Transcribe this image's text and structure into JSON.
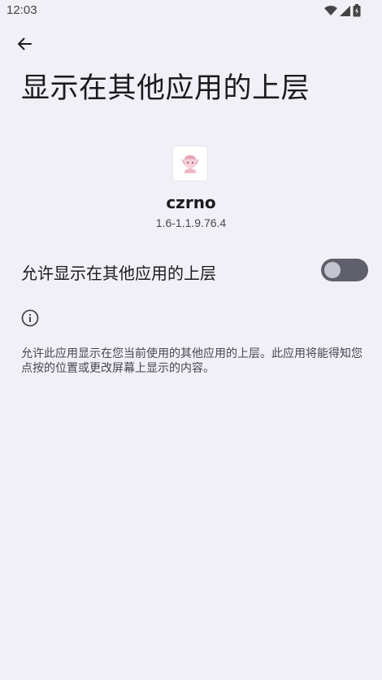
{
  "status_bar": {
    "time": "12:03",
    "icons": [
      "wifi-icon",
      "signal-icon",
      "battery-icon"
    ]
  },
  "app_bar": {
    "back_icon": "arrow-back-icon",
    "title": "显示在其他应用的上层"
  },
  "app_info": {
    "icon": "app-icon",
    "name": "czrno",
    "version": "1.6-1.1.9.76.4"
  },
  "permission": {
    "label": "允许显示在其他应用的上层",
    "enabled": false
  },
  "info": {
    "icon": "info-icon",
    "text": "允许此应用显示在您当前使用的其他应用的上层。此应用将能得知您点按的位置或更改屏幕上显示的内容。"
  },
  "colors": {
    "background": "#f1f0f6",
    "switch_track": "#5f606b",
    "switch_thumb": "#c5c5cf"
  }
}
